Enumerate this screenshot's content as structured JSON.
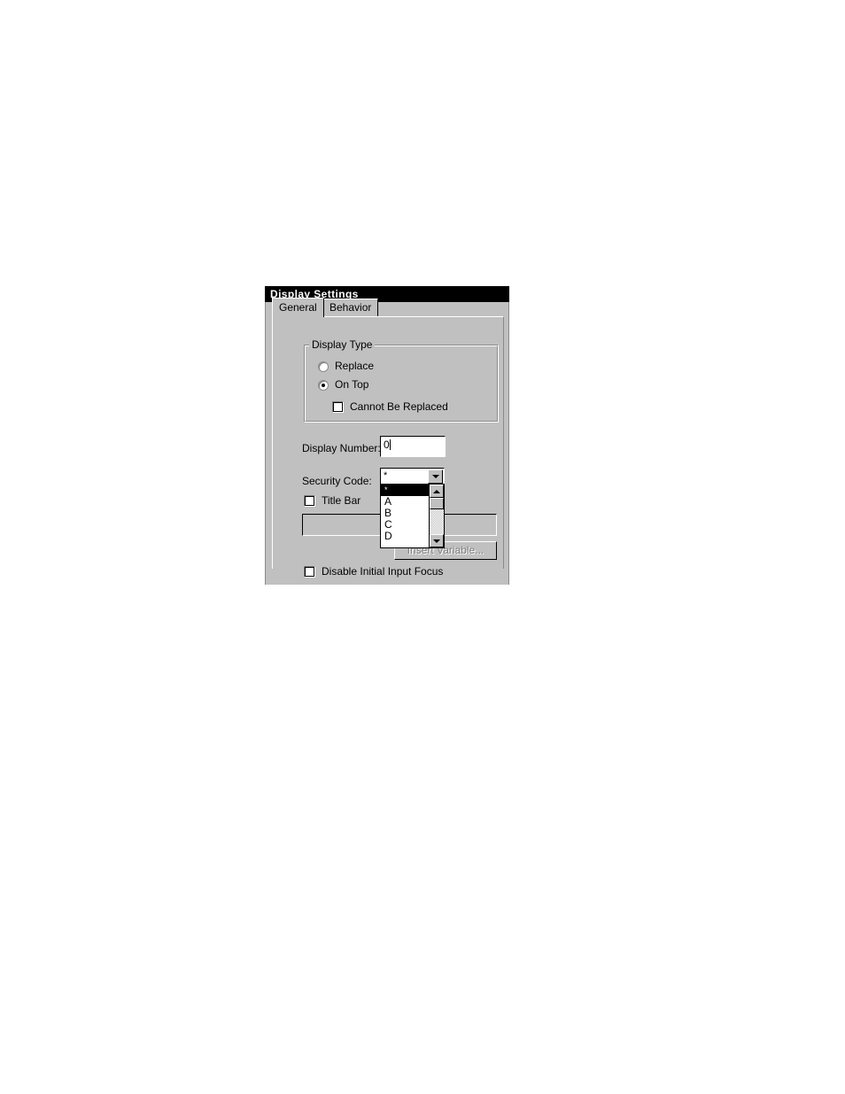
{
  "dialog": {
    "title": "Display Settings",
    "tabs": [
      {
        "label": "General",
        "active": true
      },
      {
        "label": "Behavior",
        "active": false
      }
    ],
    "display_type_group": {
      "legend": "Display Type",
      "options": [
        {
          "label": "Replace",
          "selected": false
        },
        {
          "label": "On Top",
          "selected": true
        }
      ],
      "cannot_be_replaced": {
        "label": "Cannot Be Replaced",
        "checked": false
      }
    },
    "display_number": {
      "label": "Display Number:",
      "value": "0"
    },
    "security_code": {
      "label": "Security Code:",
      "value": "*",
      "dropdown_open": true,
      "options": [
        "*",
        "A",
        "B",
        "C",
        "D"
      ],
      "selected_index": 0
    },
    "title_bar": {
      "label": "Title Bar",
      "checked": false,
      "text_value": "",
      "text_placeholder": ""
    },
    "insert_variable_button": {
      "label": "Insert Variable...",
      "disabled": true
    },
    "disable_initial_input_focus": {
      "label": "Disable Initial Input Focus",
      "checked": false
    }
  },
  "colors": {
    "dialog_face": "#c0c0c0",
    "titlebar_bg": "#000000",
    "titlebar_fg": "#ffffff",
    "highlight_bg": "#000000",
    "highlight_fg": "#ffffff",
    "disabled_text": "#808080",
    "field_bg": "#ffffff"
  }
}
